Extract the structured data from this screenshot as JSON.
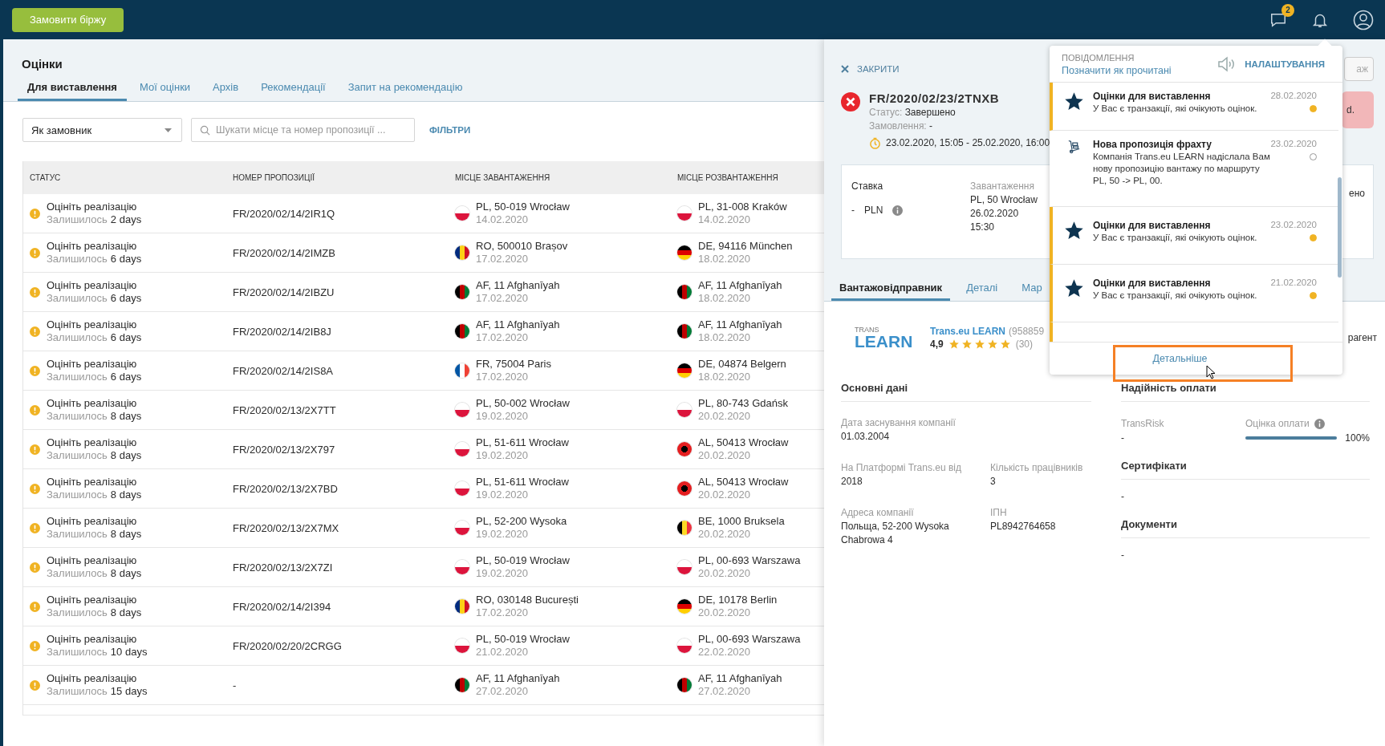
{
  "topbar": {
    "order_button": "Замовити біржу",
    "messages_badge": "2"
  },
  "page": {
    "title": "Оцінки",
    "tabs": [
      {
        "label": "Для виставлення",
        "selected": true
      },
      {
        "label": "Мої оцінки",
        "selected": false
      },
      {
        "label": "Архів",
        "selected": false
      },
      {
        "label": "Рекомендації",
        "selected": false
      },
      {
        "label": "Запит на рекомендацію",
        "selected": false
      }
    ]
  },
  "filters": {
    "role_select": "Як замовник",
    "search_placeholder": "Шукати місце та номер пропозиції ...",
    "filters_link": "ФІЛЬТРИ"
  },
  "table": {
    "columns": [
      "СТАТУС",
      "НОМЕР ПРОПОЗИЦІЇ",
      "МІСЦЕ ЗАВАНТАЖЕННЯ",
      "МІСЦЕ РОЗВАНТАЖЕННЯ"
    ],
    "rows": [
      {
        "status": "Оцініть реалізацію",
        "remaining_label": "Залишилось",
        "remaining": "2 days",
        "number": "FR/2020/02/14/2IR1Q",
        "loading": {
          "kind": "pl",
          "place": "PL, 50-019 Wrocław",
          "date": "14.02.2020"
        },
        "unloading": {
          "kind": "pl",
          "place": "PL, 31-008 Kraków",
          "date": "14.02.2020"
        }
      },
      {
        "status": "Оцініть реалізацію",
        "remaining_label": "Залишилось",
        "remaining": "6 days",
        "number": "FR/2020/02/14/2IMZB",
        "loading": {
          "kind": "ro",
          "place": "RO, 500010 Brașov",
          "date": "17.02.2020"
        },
        "unloading": {
          "kind": "de",
          "place": "DE, 94116 München",
          "date": "18.02.2020"
        }
      },
      {
        "status": "Оцініть реалізацію",
        "remaining_label": "Залишилось",
        "remaining": "6 days",
        "number": "FR/2020/02/14/2IBZU",
        "loading": {
          "kind": "af",
          "place": "AF, 11 Afghanīyah",
          "date": "17.02.2020"
        },
        "unloading": {
          "kind": "af",
          "place": "AF, 11 Afghanīyah",
          "date": "18.02.2020"
        }
      },
      {
        "status": "Оцініть реалізацію",
        "remaining_label": "Залишилось",
        "remaining": "6 days",
        "number": "FR/2020/02/14/2IB8J",
        "loading": {
          "kind": "af",
          "place": "AF, 11 Afghanīyah",
          "date": "17.02.2020"
        },
        "unloading": {
          "kind": "af",
          "place": "AF, 11 Afghanīyah",
          "date": "18.02.2020"
        }
      },
      {
        "status": "Оцініть реалізацію",
        "remaining_label": "Залишилось",
        "remaining": "6 days",
        "number": "FR/2020/02/14/2IS8A",
        "loading": {
          "kind": "fr",
          "place": "FR, 75004 Paris",
          "date": "17.02.2020"
        },
        "unloading": {
          "kind": "de",
          "place": "DE, 04874 Belgern",
          "date": "18.02.2020"
        }
      },
      {
        "status": "Оцініть реалізацію",
        "remaining_label": "Залишилось",
        "remaining": "8 days",
        "number": "FR/2020/02/13/2X7TT",
        "loading": {
          "kind": "pl",
          "place": "PL, 50-002 Wrocław",
          "date": "19.02.2020"
        },
        "unloading": {
          "kind": "pl",
          "place": "PL, 80-743 Gdańsk",
          "date": "20.02.2020"
        }
      },
      {
        "status": "Оцініть реалізацію",
        "remaining_label": "Залишилось",
        "remaining": "8 days",
        "number": "FR/2020/02/13/2X797",
        "loading": {
          "kind": "pl",
          "place": "PL, 51-611 Wrocław",
          "date": "19.02.2020"
        },
        "unloading": {
          "kind": "al",
          "place": "AL, 50413 Wrocław",
          "date": "20.02.2020"
        }
      },
      {
        "status": "Оцініть реалізацію",
        "remaining_label": "Залишилось",
        "remaining": "8 days",
        "number": "FR/2020/02/13/2X7BD",
        "loading": {
          "kind": "pl",
          "place": "PL, 51-611 Wrocław",
          "date": "19.02.2020"
        },
        "unloading": {
          "kind": "al",
          "place": "AL, 50413 Wrocław",
          "date": "20.02.2020"
        }
      },
      {
        "status": "Оцініть реалізацію",
        "remaining_label": "Залишилось",
        "remaining": "8 days",
        "number": "FR/2020/02/13/2X7MX",
        "loading": {
          "kind": "pl",
          "place": "PL, 52-200 Wysoka",
          "date": "19.02.2020"
        },
        "unloading": {
          "kind": "be",
          "place": "BE, 1000 Bruksela",
          "date": "20.02.2020"
        }
      },
      {
        "status": "Оцініть реалізацію",
        "remaining_label": "Залишилось",
        "remaining": "8 days",
        "number": "FR/2020/02/13/2X7ZI",
        "loading": {
          "kind": "pl",
          "place": "PL, 50-019 Wrocław",
          "date": "19.02.2020"
        },
        "unloading": {
          "kind": "pl",
          "place": "PL, 00-693 Warszawa",
          "date": "20.02.2020"
        }
      },
      {
        "status": "Оцініть реалізацію",
        "remaining_label": "Залишилось",
        "remaining": "8 days",
        "number": "FR/2020/02/14/2I394",
        "loading": {
          "kind": "ro",
          "place": "RO, 030148 București",
          "date": "17.02.2020"
        },
        "unloading": {
          "kind": "de",
          "place": "DE, 10178 Berlin",
          "date": "20.02.2020"
        }
      },
      {
        "status": "Оцініть реалізацію",
        "remaining_label": "Залишилось",
        "remaining": "10 days",
        "number": "FR/2020/02/20/2CRGG",
        "loading": {
          "kind": "pl",
          "place": "PL, 50-019 Wrocław",
          "date": "21.02.2020"
        },
        "unloading": {
          "kind": "pl",
          "place": "PL, 00-693 Warszawa",
          "date": "22.02.2020"
        }
      },
      {
        "status": "Оцініть реалізацію",
        "remaining_label": "Залишилось",
        "remaining": "15 days",
        "number": "-",
        "loading": {
          "kind": "af",
          "place": "AF, 11 Afghanīyah",
          "date": "27.02.2020"
        },
        "unloading": {
          "kind": "af",
          "place": "AF, 11 Afghanīyah",
          "date": "27.02.2020"
        }
      }
    ]
  },
  "detail": {
    "close": "ЗАКРИТИ",
    "number": "FR/2020/02/23/2TNXB",
    "status_label": "Статус:",
    "status": "Завершено",
    "order_label": "Замовлення:",
    "order": "-",
    "period": "23.02.2020, 15:05 - 25.02.2020, 16:00",
    "button_fragment": "аж",
    "alert_fragment": "d.",
    "summary": {
      "rate_label": "Ставка",
      "rate_value": "-",
      "currency": "PLN",
      "loading_label": "Завантаження",
      "loading_lines": [
        "PL, 50 Wrocław",
        "26.02.2020",
        "15:30"
      ],
      "fragment": "ено"
    },
    "tabs": [
      {
        "label": "Вантажовідправник",
        "selected": true
      },
      {
        "label": "Деталі",
        "selected": false
      },
      {
        "label": "Мар",
        "selected": false
      }
    ],
    "company": {
      "logo_top": "TRANS",
      "logo_main": "LEARN",
      "name": "Trans.eu LEARN",
      "id": "(958859",
      "rating": "4,9",
      "stars": 5,
      "reviews": "(30)",
      "fragment": "рагент"
    },
    "basic": {
      "title": "Основні дані",
      "fields": [
        {
          "label": "Дата заснування компанії",
          "value": "01.03.2004"
        },
        {
          "label": "На Платформі Trans.eu від",
          "value": "2018"
        },
        {
          "label": "Кількість працівників",
          "value": "3"
        },
        {
          "label": "Адреса компанії",
          "value": "Польща, 52-200 Wysoka Chabrowa 4"
        },
        {
          "label": "ІПН",
          "value": "PL8942764658"
        }
      ]
    },
    "payment": {
      "title": "Надійність оплати",
      "transrisk_label": "TransRisk",
      "transrisk": "-",
      "score_label": "Оцінка оплати",
      "level": 1,
      "reading": "100%"
    },
    "certificates": {
      "title": "Сертифікати",
      "value": "-"
    },
    "documents": {
      "title": "Документи",
      "value": "-"
    }
  },
  "notifications": {
    "title": "ПОВІДОМЛЕННЯ",
    "mark_read": "Позначити як прочитані",
    "settings": "НАЛАШТУВАННЯ",
    "items": [
      {
        "kind": "rating",
        "title": "Оцінки для виставлення",
        "text": "У Вас є транзакції, які очікують оцінок.",
        "date": "28.02.2020",
        "unread": true
      },
      {
        "kind": "offer",
        "title": "Нова пропозиція фрахту",
        "text": "Компанія Trans.eu LEARN надіслала Вам нову пропозицію вантажу по маршруту PL, 50 -> PL, 00.",
        "date": "23.02.2020",
        "unread": false
      },
      {
        "kind": "rating",
        "title": "Оцінки для виставлення",
        "text": "У Вас є транзакції, які очікують оцінок.",
        "date": "23.02.2020",
        "unread": true
      },
      {
        "kind": "rating",
        "title": "Оцінки для виставлення",
        "text": "У Вас є транзакції, які очікують оцінок.",
        "date": "21.02.2020",
        "unread": true
      }
    ],
    "more": "Детальніше"
  }
}
